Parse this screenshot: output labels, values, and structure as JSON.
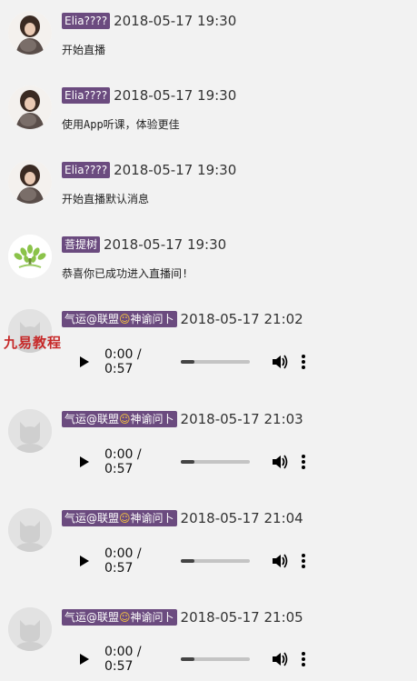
{
  "messages": [
    {
      "type": "text",
      "avatar": "girl-avatar",
      "name": "Elia????",
      "time": "2018-05-17 19:30",
      "text": "开始直播"
    },
    {
      "type": "text",
      "avatar": "girl-avatar",
      "name": "Elia????",
      "time": "2018-05-17 19:30",
      "text": "使用App听课，体验更佳"
    },
    {
      "type": "text",
      "avatar": "girl-avatar",
      "name": "Elia????",
      "time": "2018-05-17 19:30",
      "text": "开始直播默认消息"
    },
    {
      "type": "text",
      "avatar": "bodhi-tree-logo",
      "name": "菩提树",
      "time": "2018-05-17 19:30",
      "text": "恭喜你已成功进入直播间!"
    },
    {
      "type": "audio",
      "avatar": "default-cat-avatar",
      "name_prefix": "气运@联盟",
      "name_suffix": "神谕问卜",
      "emoji": "☺",
      "time": "2018-05-17 21:02",
      "audio_time": "0:00 / 0:57",
      "progress": 0.2
    },
    {
      "type": "audio",
      "avatar": "default-cat-avatar",
      "name_prefix": "气运@联盟",
      "name_suffix": "神谕问卜",
      "emoji": "☺",
      "time": "2018-05-17 21:03",
      "audio_time": "0:00 / 0:57",
      "progress": 0.2
    },
    {
      "type": "audio",
      "avatar": "default-cat-avatar",
      "name_prefix": "气运@联盟",
      "name_suffix": "神谕问卜",
      "emoji": "☺",
      "time": "2018-05-17 21:04",
      "audio_time": "0:00 / 0:57",
      "progress": 0.2
    },
    {
      "type": "audio",
      "avatar": "default-cat-avatar",
      "name_prefix": "气运@联盟",
      "name_suffix": "神谕问卜",
      "emoji": "☺",
      "time": "2018-05-17 21:05",
      "audio_time": "0:00 / 0:57",
      "progress": 0.2
    }
  ],
  "watermark": "九易教程",
  "colors": {
    "name_badge": "#6b4b7f",
    "background": "#f2f2f2",
    "watermark": "#c62828"
  }
}
